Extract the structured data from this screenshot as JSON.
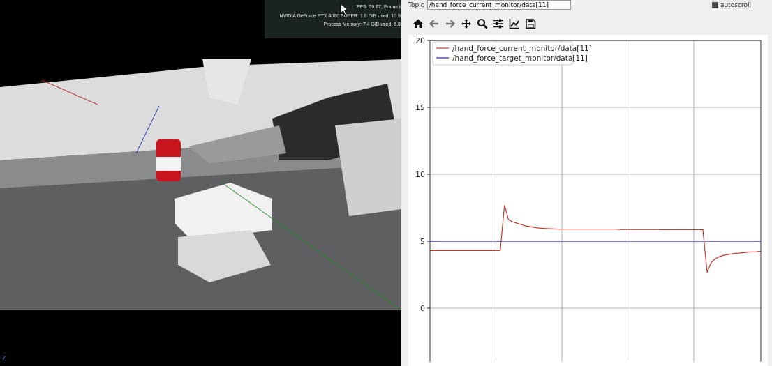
{
  "viewport": {
    "kind": "picture",
    "stats": [
      "FPS: 59.87, Frame t",
      "NVIDIA GeForce RTX 4080 SUPER: 1.8 GiB used, 10.9",
      "Process Memory: 7.4 GiB used, 6.8"
    ],
    "axis_label": "Z"
  },
  "plot_panel": {
    "topic_label": "Topic",
    "topic_value": "/hand_force_current_monitor/data[11]",
    "autoscroll": {
      "label": "autoscroll",
      "checked": true
    },
    "toolbar": [
      {
        "kind": "home",
        "disabled": false
      },
      {
        "kind": "back",
        "disabled": true
      },
      {
        "kind": "forward",
        "disabled": true
      },
      {
        "kind": "pan",
        "disabled": false
      },
      {
        "kind": "zoom",
        "disabled": false
      },
      {
        "kind": "configure",
        "disabled": false
      },
      {
        "kind": "axes",
        "disabled": false
      },
      {
        "kind": "save",
        "disabled": false
      }
    ],
    "chart_data": {
      "type": "line",
      "grid": true,
      "legend": true,
      "categories": [
        null,
        null,
        null,
        null,
        null,
        null,
        null,
        null,
        null,
        null,
        null,
        null,
        null,
        null,
        null,
        null,
        null,
        null,
        null,
        null,
        null,
        null,
        null,
        null,
        null,
        null,
        null,
        null,
        null,
        null,
        null,
        null,
        null,
        null,
        null,
        null,
        null,
        null,
        null,
        null,
        null,
        null,
        null,
        null,
        null,
        null,
        null,
        null,
        null,
        null,
        null,
        null,
        null,
        null,
        null,
        null,
        null,
        null,
        null,
        null,
        null,
        null,
        null,
        null,
        null,
        null,
        null,
        null,
        null,
        null,
        null,
        null,
        null,
        null,
        null,
        null,
        null,
        null,
        null,
        null,
        null
      ],
      "ylim": [
        -4,
        20
      ],
      "yticks": [
        {
          "value": 0,
          "label": "0"
        },
        {
          "value": 5,
          "label": "5"
        },
        {
          "value": 10,
          "label": "10"
        },
        {
          "value": 15,
          "label": "15"
        },
        {
          "value": 20,
          "label": "20"
        }
      ],
      "series": [
        {
          "name": "/hand_force_current_monitor/data[11]",
          "color": "#c0392b",
          "values": [
            4.3,
            4.3,
            4.3,
            4.3,
            4.3,
            4.3,
            4.3,
            4.3,
            4.3,
            4.3,
            4.3,
            4.3,
            4.3,
            4.3,
            4.3,
            4.3,
            4.3,
            4.3,
            7.7,
            6.6,
            6.45,
            6.35,
            6.25,
            6.15,
            6.1,
            6.05,
            6.0,
            5.97,
            5.95,
            5.93,
            5.92,
            5.9,
            5.9,
            5.9,
            5.9,
            5.9,
            5.9,
            5.9,
            5.9,
            5.9,
            5.9,
            5.9,
            5.9,
            5.9,
            5.9,
            5.9,
            5.88,
            5.88,
            5.88,
            5.88,
            5.88,
            5.88,
            5.88,
            5.88,
            5.88,
            5.88,
            5.86,
            5.86,
            5.86,
            5.86,
            5.86,
            5.86,
            5.86,
            5.86,
            5.86,
            5.86,
            5.85,
            2.7,
            3.4,
            3.7,
            3.85,
            3.95,
            4.0,
            4.05,
            4.1,
            4.12,
            4.15,
            4.18,
            4.2,
            4.22,
            4.25
          ]
        },
        {
          "name": "/hand_force_target_monitor/data[11]",
          "color": "#1f1f9f",
          "values": [
            5,
            5,
            5,
            5,
            5,
            5,
            5,
            5,
            5,
            5,
            5,
            5,
            5,
            5,
            5,
            5,
            5,
            5,
            5,
            5,
            5,
            5,
            5,
            5,
            5,
            5,
            5,
            5,
            5,
            5,
            5,
            5,
            5,
            5,
            5,
            5,
            5,
            5,
            5,
            5,
            5,
            5,
            5,
            5,
            5,
            5,
            5,
            5,
            5,
            5,
            5,
            5,
            5,
            5,
            5,
            5,
            5,
            5,
            5,
            5,
            5,
            5,
            5,
            5,
            5,
            5,
            5,
            5,
            5,
            5,
            5,
            5,
            5,
            5,
            5,
            5,
            5,
            5,
            5,
            5,
            5
          ]
        }
      ]
    }
  }
}
